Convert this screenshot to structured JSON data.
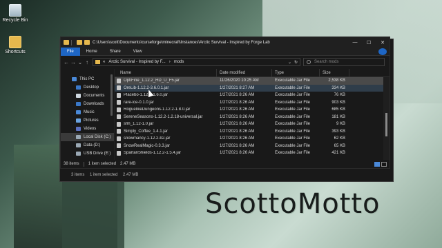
{
  "desktop": {
    "icons": [
      {
        "label": "Recycle Bin",
        "icon": "recycle-bin-icon"
      },
      {
        "label": "Shortcuts",
        "icon": "folder-shortcut-icon"
      }
    ],
    "brand_text": "ScottoMotto"
  },
  "back_window": {
    "status": {
      "count": "3 items",
      "selected": "1 item selected",
      "size": "2.47 MB"
    }
  },
  "window": {
    "path": "C:\\Users\\scott\\Documents\\curseforge\\minecraft\\Instances\\Arctic Survival - Inspired by Forge Lab",
    "controls": {
      "minimize": "—",
      "maximize": "☐",
      "close": "✕"
    },
    "ribbon_tabs": [
      "File",
      "Home",
      "Share",
      "View"
    ],
    "address": {
      "crumbs": [
        "«",
        "Arctic Survival - Inspired by F...",
        "›",
        "mods"
      ],
      "dropdown": "⌄",
      "refresh": "↻"
    },
    "search": {
      "placeholder": "Search mods"
    },
    "nav": {
      "back": "←",
      "forward": "→",
      "down": "⌄",
      "up": "↑"
    },
    "sidebar": [
      {
        "label": "This PC",
        "icon": "computer-icon"
      },
      {
        "label": "Desktop",
        "icon": "desktop-icon"
      },
      {
        "label": "Documents",
        "icon": "documents-icon"
      },
      {
        "label": "Downloads",
        "icon": "downloads-icon"
      },
      {
        "label": "Music",
        "icon": "music-icon"
      },
      {
        "label": "Pictures",
        "icon": "pictures-icon"
      },
      {
        "label": "Videos",
        "icon": "videos-icon"
      },
      {
        "label": "Local Disk (C:)",
        "icon": "disk-icon"
      },
      {
        "label": "Data (D:)",
        "icon": "disk-icon"
      },
      {
        "label": "USB Drive (E:)",
        "icon": "usb-drive-icon"
      }
    ],
    "columns": {
      "name": "Name",
      "date": "Date modified",
      "type": "Type",
      "size": "Size"
    },
    "files": [
      {
        "name": "OptiFine_1.12.2_HD_U_F5.jar",
        "date": "11/26/2020 10:25 AM",
        "type": "Executable Jar File",
        "size": "2,538 KB"
      },
      {
        "name": "OreLib-1.12.2-3.6.0.1.jar",
        "date": "1/27/2021 8:27 AM",
        "type": "Executable Jar File",
        "size": "334 KB"
      },
      {
        "name": "Placebo-1.12.2-1.6.0.jar",
        "date": "1/27/2021 8:26 AM",
        "type": "Executable Jar File",
        "size": "76 KB"
      },
      {
        "name": "rare-ice-0.1.0.jar",
        "date": "1/27/2021 8:26 AM",
        "type": "Executable Jar File",
        "size": "903 KB"
      },
      {
        "name": "RoguelikeDungeons-1.12.2-1.8.0.jar",
        "date": "1/27/2021 8:26 AM",
        "type": "Executable Jar File",
        "size": "685 KB"
      },
      {
        "name": "SereneSeasons-1.12.2-1.2.18-universal.jar",
        "date": "1/27/2021 8:26 AM",
        "type": "Executable Jar File",
        "size": "181 KB"
      },
      {
        "name": "sfm_1.12-1.0.jar",
        "date": "1/27/2021 8:26 AM",
        "type": "Executable Jar File",
        "size": "9 KB"
      },
      {
        "name": "Simply_Coffee_1.4.1.jar",
        "date": "1/27/2021 8:26 AM",
        "type": "Executable Jar File",
        "size": "393 KB"
      },
      {
        "name": "snowmancy-1.12.2-b2.jar",
        "date": "1/27/2021 8:26 AM",
        "type": "Executable Jar File",
        "size": "62 KB"
      },
      {
        "name": "SnowRealMagic-0.3.3.jar",
        "date": "1/27/2021 8:26 AM",
        "type": "Executable Jar File",
        "size": "65 KB"
      },
      {
        "name": "SpartanShields-1.12.2-1.5.4.jar",
        "date": "1/27/2021 8:26 AM",
        "type": "Executable Jar File",
        "size": "421 KB"
      }
    ],
    "status": {
      "count": "38 items",
      "selected": "1 item selected",
      "size": "2.47 MB"
    }
  }
}
